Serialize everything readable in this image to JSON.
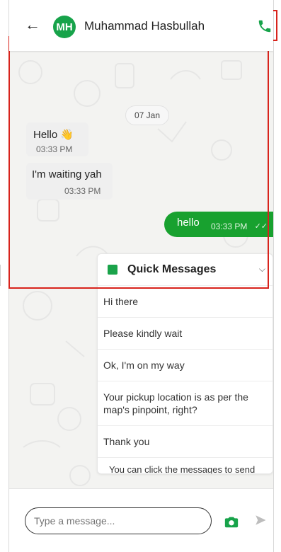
{
  "header": {
    "back_icon": "arrow-left-icon",
    "avatar_initials": "MH",
    "contact_name": "Muhammad Hasbullah",
    "call_icon": "phone-icon",
    "colors": {
      "accent": "#17a34a"
    }
  },
  "chat": {
    "date_chip": "07 Jan",
    "incoming": [
      {
        "text": "Hello 👋",
        "time": "03:33 PM"
      },
      {
        "text": "I'm waiting yah",
        "time": "03:33 PM"
      }
    ],
    "outgoing": [
      {
        "text": "hello",
        "time": "03:33 PM",
        "status_icon": "double-check-icon"
      }
    ]
  },
  "quick_messages": {
    "title": "Quick Messages",
    "icon": "message-icon",
    "chevron": "chevron-down-icon",
    "items": [
      "Hi there",
      "Please kindly wait",
      "Ok, I'm on my way",
      "Your pickup location is as per the map's pinpoint, right?",
      "Thank you"
    ],
    "footer": "You can click the messages to send to your driver."
  },
  "composer": {
    "placeholder": "Type a message...",
    "camera_icon": "camera-icon",
    "send_icon": "send-icon"
  }
}
